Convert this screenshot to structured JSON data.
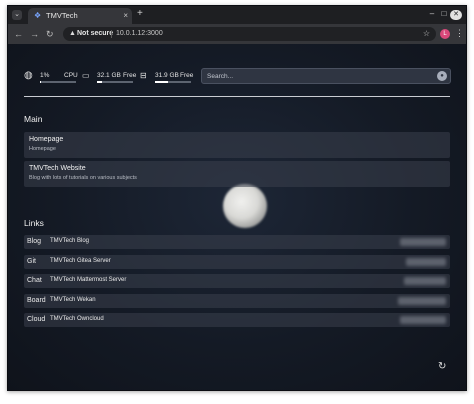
{
  "browser": {
    "tab_title": "TMVTech",
    "tab_close": "×",
    "new_tab": "+",
    "address_security": "Not secure",
    "address_url": "10.0.1.12:3000",
    "profile_initial": "L"
  },
  "stats": {
    "cpu_value": "1%",
    "cpu_label": "CPU",
    "cpu_fraction": 0.01,
    "ram_value": "32.1 GB",
    "ram_label": "Free",
    "ram_fraction": 0.15,
    "disk_value": "31.9 GB",
    "disk_label": "Free",
    "disk_fraction": 0.35
  },
  "search": {
    "placeholder": "Search..."
  },
  "main": {
    "heading": "Main",
    "apps": [
      {
        "name": "Homepage",
        "description": "Homepage"
      },
      {
        "name": "TMVTech Website",
        "description": "Blog with lots of tutorials on various subjects"
      }
    ]
  },
  "links": {
    "heading": "Links",
    "items": [
      {
        "category": "Blog",
        "name": "TMVTech Blog"
      },
      {
        "category": "Git",
        "name": "TMVTech Gitea Server"
      },
      {
        "category": "Chat",
        "name": "TMVTech Mattermost Server"
      },
      {
        "category": "Board",
        "name": "TMVTech Wekan"
      },
      {
        "category": "Cloud",
        "name": "TMVTech Owncloud"
      }
    ]
  },
  "colors": {
    "page_bg": "#141a25",
    "card_bg": "#3a404c",
    "divider": "#c9ccd2",
    "profile": "#d9487a"
  },
  "icons": [
    "globe-icon",
    "ram-icon",
    "disk-icon",
    "search-icon",
    "refresh-icon"
  ]
}
